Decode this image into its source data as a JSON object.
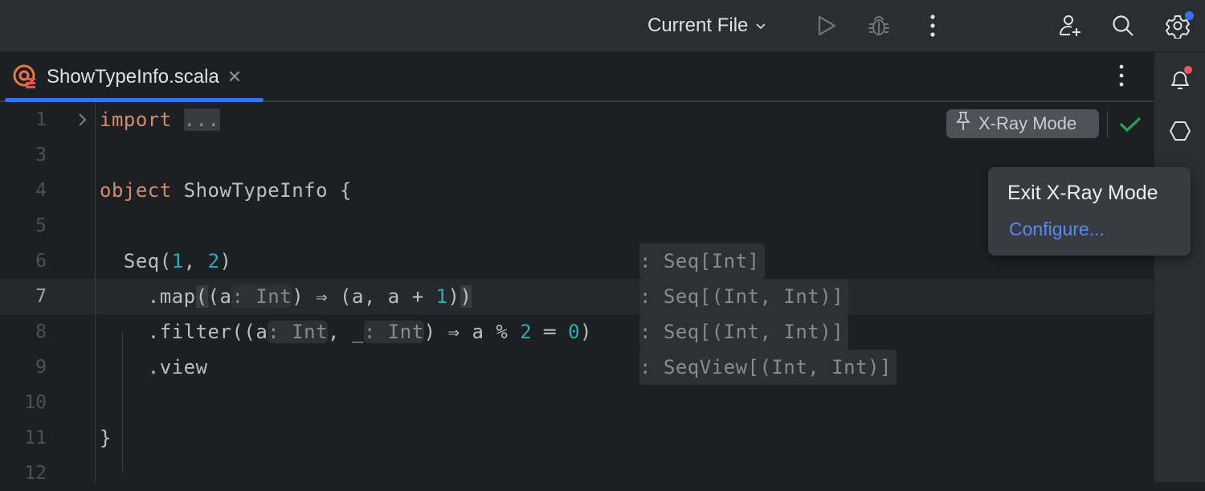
{
  "toolbar": {
    "run_config": "Current File",
    "icons": [
      "chevron-down-icon",
      "run-icon",
      "debug-icon",
      "more-vertical-icon",
      "add-user-icon",
      "search-icon",
      "settings-icon"
    ],
    "settings_badge_color": "#3574f0"
  },
  "tabs": [
    {
      "label": "ShowTypeInfo.scala",
      "icon": "scala-file-icon",
      "active": true
    }
  ],
  "editor": {
    "current_line": 7,
    "lines": [
      {
        "number": "1"
      },
      {
        "number": "3"
      },
      {
        "number": "4"
      },
      {
        "number": "5"
      },
      {
        "number": "6"
      },
      {
        "number": "7"
      },
      {
        "number": "8"
      },
      {
        "number": "9"
      },
      {
        "number": "10"
      },
      {
        "number": "11"
      },
      {
        "number": "12"
      }
    ],
    "code": {
      "l1_kw": "import",
      "l1_fold": "...",
      "l4_kw": "object",
      "l4_rest": " ShowTypeInfo {",
      "l6_a": "  Seq(",
      "l6_n1": "1",
      "l6_b": ", ",
      "l6_n2": "2",
      "l6_c": ")",
      "l7_a": "    .map",
      "l7_b": "(",
      "l7_c": "(a",
      "l7_hint": ": Int",
      "l7_d": ") ⇒ (a, a + ",
      "l7_n": "1",
      "l7_e": ")",
      "l7_f": ")",
      "l8_a": "    .filter((a",
      "l8_hint1": ": Int",
      "l8_b": ", _",
      "l8_hint2": ": Int",
      "l8_c": ") ⇒ a % ",
      "l8_n1": "2",
      "l8_d": " ═ ",
      "l8_n2": "0",
      "l8_e": ")",
      "l9": "    .view",
      "l11": "}"
    },
    "type_hints": [
      ": Seq[Int]",
      ": Seq[(Int, Int)]",
      ": Seq[(Int, Int)]",
      ": SeqView[(Int, Int)]"
    ]
  },
  "xray": {
    "badge_label": "X-Ray Mode",
    "badge_icon": "pin-icon",
    "status_icon": "check-icon",
    "status_color": "#2ba35d"
  },
  "right_strip": {
    "icons": [
      "notifications-icon",
      "ai-assistant-icon"
    ],
    "notification_badge_color": "#f75464"
  },
  "popup": {
    "title": "Exit X-Ray Mode",
    "link": "Configure..."
  },
  "colors": {
    "accent": "#3574f0",
    "keyword": "#cf8e6d",
    "number": "#2aacb8",
    "link": "#548af7"
  }
}
